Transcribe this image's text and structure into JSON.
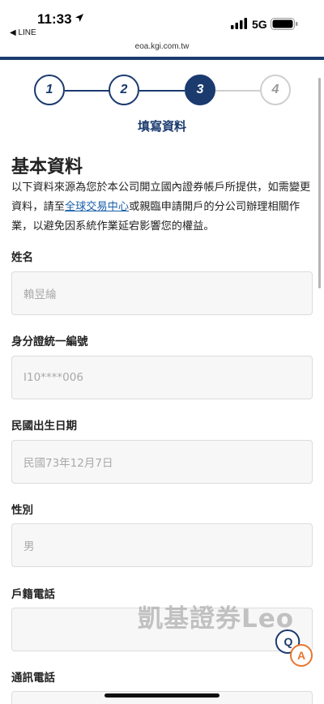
{
  "status_bar": {
    "time": "11:33",
    "back_app": "◀ LINE",
    "network": "5G"
  },
  "browser": {
    "url": "eoa.kgi.com.tw"
  },
  "stepper": {
    "steps": [
      {
        "label": "1",
        "state": "done"
      },
      {
        "label": "2",
        "state": "done"
      },
      {
        "label": "3",
        "state": "active"
      },
      {
        "label": "4",
        "state": "todo"
      }
    ],
    "current_caption": "填寫資料"
  },
  "section": {
    "title": "基本資料",
    "intro_before_link": "以下資料來源為您於本公司開立國內證券帳戶所提供，如需變更資料，請至",
    "intro_link": "全球交易中心",
    "intro_after_link": "或親臨申請開戶的分公司辦理相關作業，以避免因系統作業延宕影響您的權益。"
  },
  "fields": [
    {
      "label": "姓名",
      "value": "賴昱綸"
    },
    {
      "label": "身分證統一編號",
      "value": "I10****006"
    },
    {
      "label": "民國出生日期",
      "value": "民國73年12月7日"
    },
    {
      "label": "性別",
      "value": "男"
    },
    {
      "label": "戶籍電話",
      "value": ""
    },
    {
      "label": "通訊電話",
      "value": ""
    }
  ],
  "watermark": "凱基證券Leo",
  "fab": {
    "q_label": "Q",
    "a_label": "A"
  },
  "colors": {
    "brand": "#1b3b6f",
    "link": "#1a5ea8",
    "fab_accent": "#e8772e"
  }
}
